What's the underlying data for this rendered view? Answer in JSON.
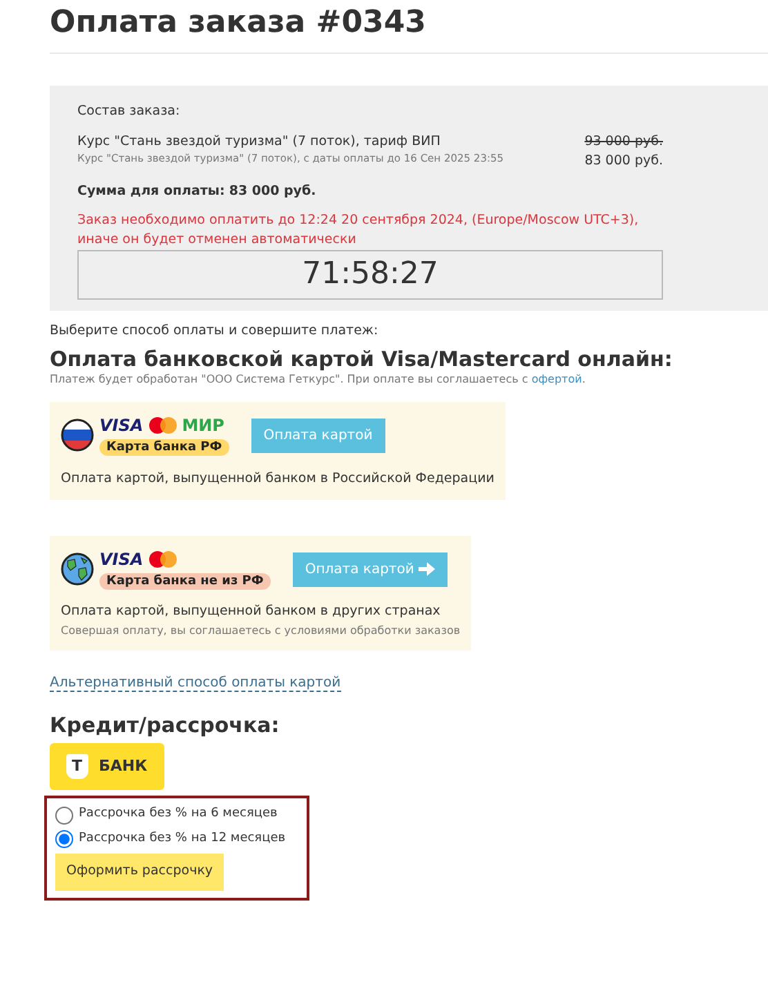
{
  "title": "Оплата заказа #0343",
  "order": {
    "heading": "Состав заказа:",
    "item": {
      "name": "Курс \"Стань звездой туризма\" (7 поток), тариф ВИП",
      "detail": "Курс \"Стань звездой туризма\" (7 поток), с даты оплаты до 16 Сен 2025 23:55",
      "old_price": "93 000 руб.",
      "price": "83 000 руб."
    },
    "total": "**Сумма для оплаты:** **83 000 руб.**",
    "deadline": [
      "Заказ необходимо оплатить до 12:24 20 сентября 2024, (Europe/Moscow UTC+3),",
      "иначе он будет отменен автоматически"
    ],
    "timer": "71:58:27"
  },
  "choose": "Выберите способ оплаты и совершите платеж:",
  "card_section": {
    "heading": "Оплата банковской картой Visa/Mastercard онлайн:",
    "note": "Платеж будет обработан \"ООО Система Геткурс\". При оплате вы соглашаетесь с",
    "note_link": "офертой",
    "note_end": "."
  },
  "options": [
    {
      "kind": "russia",
      "brands": [
        "VISA",
        "МИР"
      ],
      "tag": "Карта банка РФ",
      "button": "Оплата картой",
      "arrow": false,
      "description": "Оплата картой, выпущенной банком в Российской Федерации"
    },
    {
      "kind": "world",
      "brands": [
        "VISA"
      ],
      "tag": "Карта банка не из РФ",
      "button": "Оплата картой",
      "arrow": true,
      "description": "Оплата картой, выпущенной банком в других странах",
      "terms": "Совершая оплату, вы соглашаетесь с условиями обработки заказов"
    }
  ],
  "alt_link": "Альтернативный способ оплаты картой",
  "credit": {
    "heading": "Кредит/рассрочка:",
    "bank_letter": "Т",
    "bank_name": "БАНК",
    "plans": [
      {
        "label": "Рассрочка без % на 6 месяцев",
        "selected": false
      },
      {
        "label": "Рассрочка без % на 12 месяцев",
        "selected": true
      }
    ],
    "button": "Оформить рассрочку"
  }
}
